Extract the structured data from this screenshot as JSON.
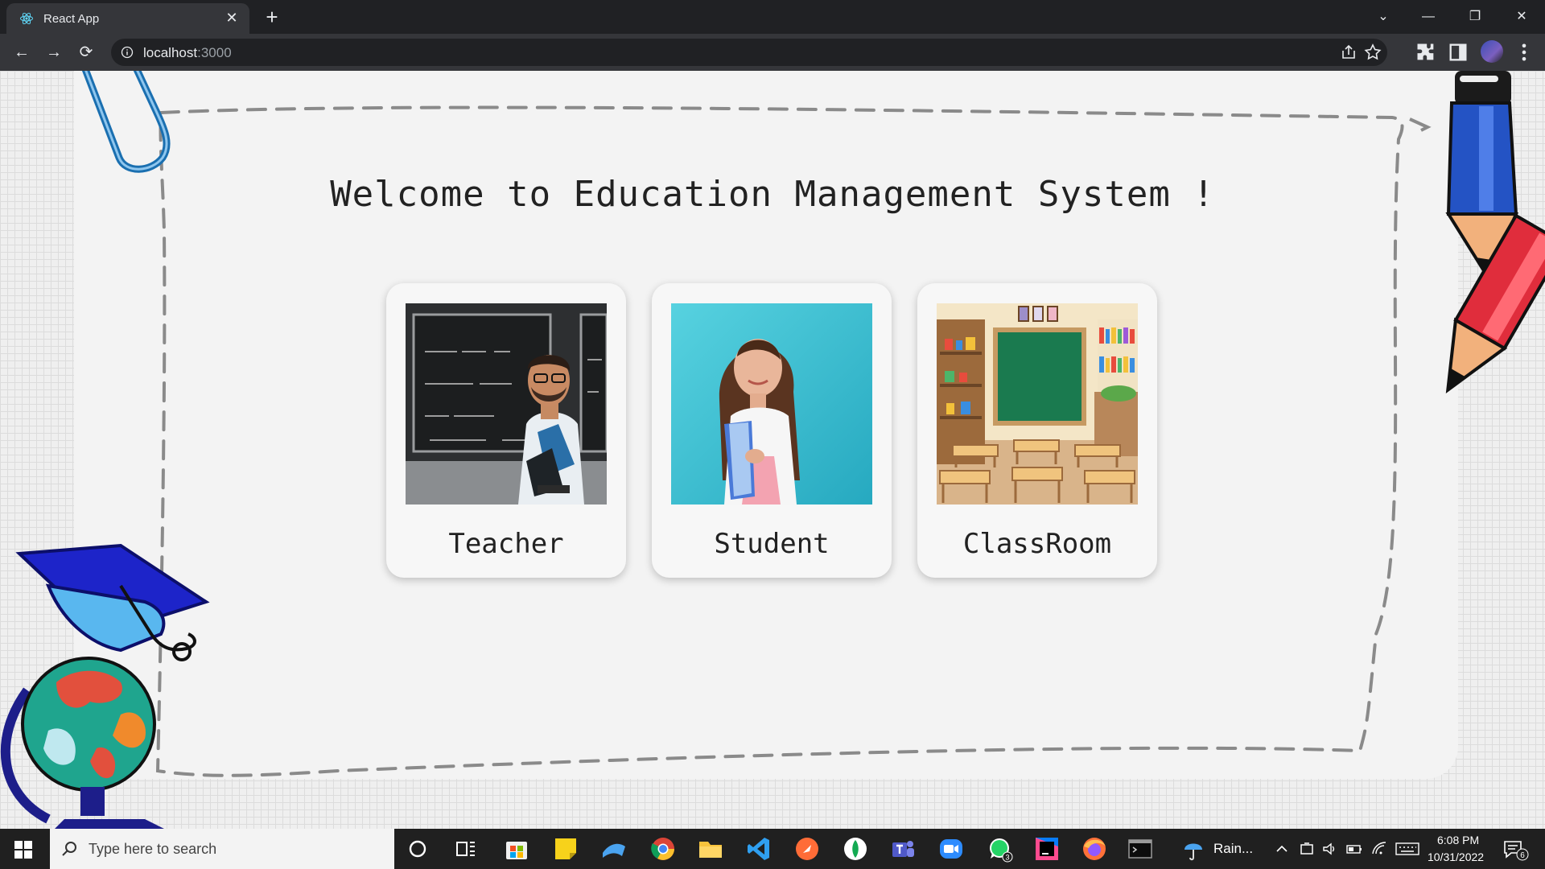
{
  "browser": {
    "tab_title": "React App",
    "tab_close_glyph": "✕",
    "new_tab_glyph": "+",
    "url_host": "localhost",
    "url_port": ":3000",
    "window_controls": {
      "tab_search": "⌄",
      "minimize": "—",
      "restore": "❐",
      "close": "✕"
    },
    "nav": {
      "back": "←",
      "forward": "→",
      "reload": "⟳"
    },
    "icons": [
      "share-icon",
      "star-icon",
      "extensions-icon",
      "side-panel-icon",
      "profile-avatar",
      "menu-icon"
    ]
  },
  "page": {
    "heading": "Welcome to Education Management System !",
    "cards": [
      {
        "label": "Teacher",
        "image": "teacher-photo"
      },
      {
        "label": "Student",
        "image": "student-photo"
      },
      {
        "label": "ClassRoom",
        "image": "classroom-illustration"
      }
    ]
  },
  "taskbar": {
    "search_placeholder": "Type here to search",
    "apps": [
      "cortana-icon",
      "task-view-icon",
      "microsoft-store-icon",
      "sticky-notes-icon",
      "azure-data-studio-icon",
      "chrome-icon",
      "file-explorer-icon",
      "vscode-icon",
      "postman-icon",
      "mongodb-compass-icon",
      "teams-icon",
      "zoom-icon",
      "whatsapp-icon",
      "intellij-icon",
      "firefox-icon",
      "terminal-icon"
    ],
    "whatsapp_badge": "3",
    "weather_label": "Rain...",
    "time": "6:08 PM",
    "date": "10/31/2022",
    "notification_badge": "6"
  },
  "colors": {
    "chrome_dark": "#202124",
    "chrome_toolbar": "#35363a",
    "taskbar": "#202020",
    "page_background": "#f3f3f3"
  }
}
